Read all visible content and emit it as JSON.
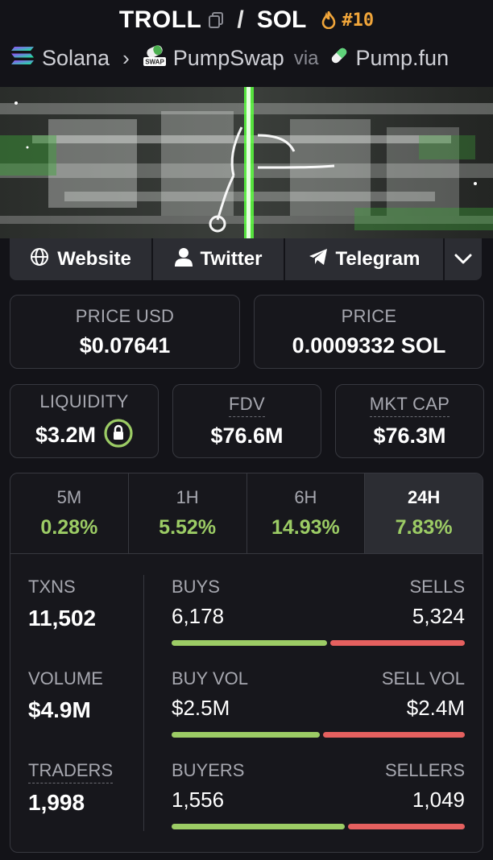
{
  "header": {
    "token": "TROLL",
    "separator": "/",
    "quote": "SOL",
    "rank": "#10"
  },
  "breadcrumb": {
    "chain": "Solana",
    "dex": "PumpSwap",
    "via": "via",
    "launchpad": "Pump.fun"
  },
  "links": {
    "website": "Website",
    "twitter": "Twitter",
    "telegram": "Telegram"
  },
  "price_cards": {
    "price_usd_label": "PRICE USD",
    "price_usd": "$0.07641",
    "price_label": "PRICE",
    "price_native": "0.0009332 SOL"
  },
  "metric_cards": {
    "liquidity_label": "LIQUIDITY",
    "liquidity": "$3.2M",
    "fdv_label": "FDV",
    "fdv": "$76.6M",
    "mkt_cap_label": "MKT CAP",
    "mkt_cap": "$76.3M"
  },
  "timeframes": [
    {
      "label": "5M",
      "change": "0.28%"
    },
    {
      "label": "1H",
      "change": "5.52%"
    },
    {
      "label": "6H",
      "change": "14.93%"
    },
    {
      "label": "24H",
      "change": "7.83%"
    }
  ],
  "selected_timeframe": "24H",
  "stats": {
    "txns_label": "TXNS",
    "txns": "11,502",
    "volume_label": "VOLUME",
    "volume": "$4.9M",
    "traders_label": "TRADERS",
    "traders": "1,998",
    "buys_label": "BUYS",
    "buys": "6,178",
    "sells_label": "SELLS",
    "sells": "5,324",
    "buys_share": 0.537,
    "buy_vol_label": "BUY VOL",
    "buy_vol": "$2.5M",
    "sell_vol_label": "SELL VOL",
    "sell_vol": "$2.4M",
    "buy_vol_share": 0.51,
    "buyers_label": "BUYERS",
    "buyers": "1,556",
    "sellers_label": "SELLERS",
    "sellers": "1,049",
    "buyers_share": 0.597
  },
  "colors": {
    "positive": "#9ccc65",
    "negative": "#e5605f",
    "accent_rank": "#f0a53a",
    "background": "#131318",
    "card_border": "#37383f"
  },
  "icons": {
    "copy": "copy-icon",
    "rank": "flame-icon",
    "chain": "solana-icon",
    "dex": "pumpswap-icon",
    "launchpad": "pill-icon",
    "website": "globe-icon",
    "twitter": "user-icon",
    "telegram": "send-icon",
    "more": "chevron-down-icon",
    "liquidity_lock": "lock-icon"
  }
}
